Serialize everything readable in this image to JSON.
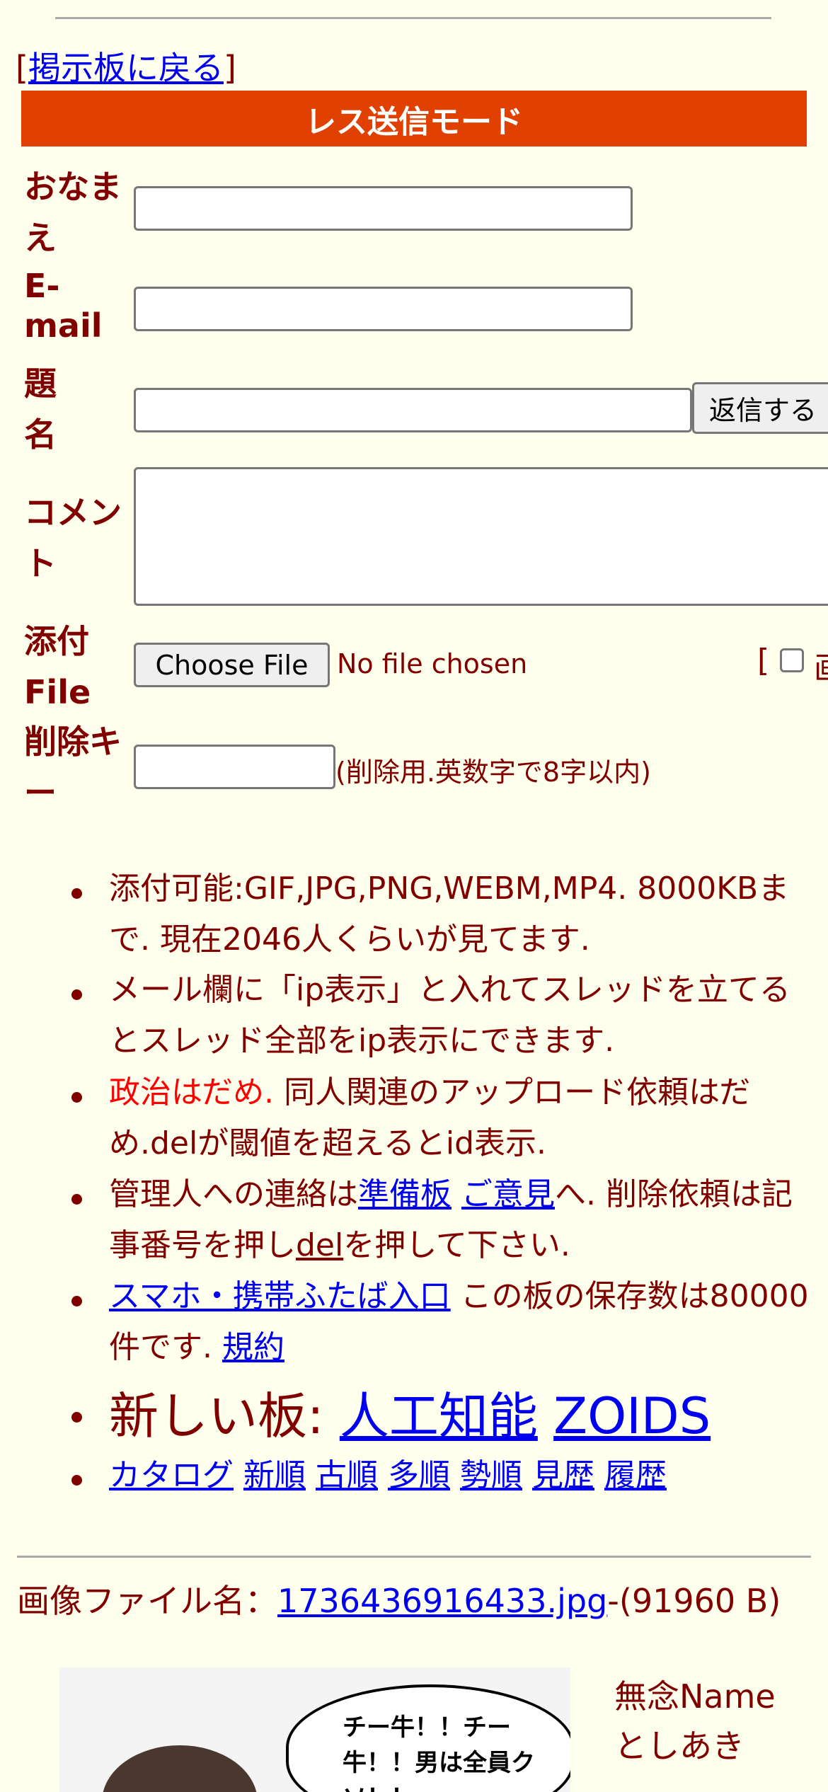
{
  "nav": {
    "back_prefix": "[",
    "back_link": "掲示板に戻る",
    "back_suffix": "]"
  },
  "banner": {
    "title": "レス送信モード"
  },
  "form": {
    "name_label": "おなまえ",
    "email_label": "E-mail",
    "subject_label": "題名",
    "submit_label": "返信する",
    "comment_label": "コメント",
    "file_label": "添付File",
    "choose_file_label": "Choose File",
    "no_file_text": "No file chosen",
    "image_option_prefix": "[",
    "image_option_text": "画",
    "delkey_label": "削除キー",
    "delkey_hint": "(削除用.英数字で8字以内)"
  },
  "rules": {
    "r1": "添付可能:GIF,JPG,PNG,WEBM,MP4. 8000KBまで. 現在2046人くらいが見てます.",
    "r2": "メール欄に「ip表示」と入れてスレッドを立てるとスレッド全部をip表示にできます.",
    "r3_red": "政治はだめ.",
    "r3_rest": " 同人関連のアップロード依頼はだめ.delが閾値を超えるとid表示.",
    "r4_a": "管理人への連絡は",
    "r4_link1": "準備板",
    "r4_link2": "ご意見",
    "r4_b": "へ. 削除依頼は記事番号を押し",
    "r4_link3": "del",
    "r4_c": "を押して下さい.",
    "r5_link": "スマホ・携帯ふたば入口",
    "r5_text": " この板の保存数は80000件です. ",
    "r5_link2": "規約",
    "r6_prefix": "新しい板: ",
    "r6_link1": "人工知能",
    "r6_link2": "ZOIDS",
    "r7_links": [
      "カタログ",
      "新順",
      "古順",
      "多順",
      "勢順",
      "見歴",
      "履歴"
    ]
  },
  "post": {
    "file_prefix": "画像ファイル名：",
    "file_link": "1736436916433.jpg",
    "file_size": "-(91960 B)",
    "thumb_text": "チー牛！！チー牛！！男は全員クソ！！",
    "name_line": "無念Name",
    "poster": "としあき"
  }
}
